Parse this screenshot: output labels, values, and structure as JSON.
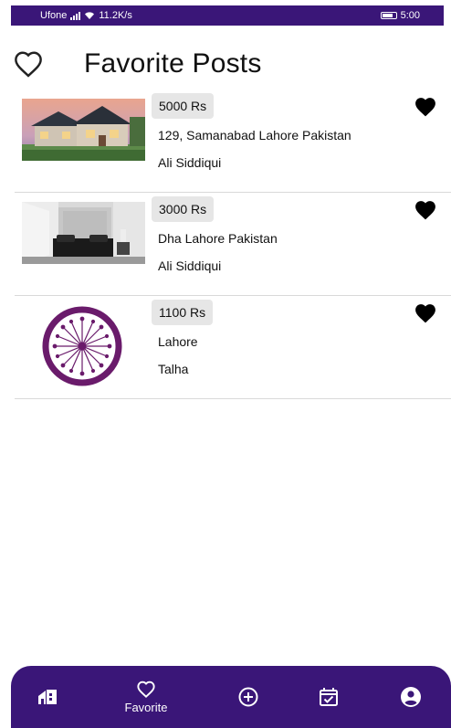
{
  "status_bar": {
    "carrier": "Ufone",
    "network_speed": "11.2K/s",
    "time": "5:00"
  },
  "header": {
    "title": "Favorite Posts",
    "icon": "heart-outline-icon"
  },
  "posts": [
    {
      "price": "5000 Rs",
      "address": "129, Samanabad Lahore Pakistan",
      "owner": "Ali Siddiqui",
      "image": "house-photo",
      "favorited": true
    },
    {
      "price": "3000 Rs",
      "address": "Dha Lahore Pakistan",
      "owner": "Ali Siddiqui",
      "image": "bedroom-photo",
      "favorited": true
    },
    {
      "price": "1100 Rs",
      "address": "Lahore",
      "owner": "Talha",
      "image": "purple-circle-logo",
      "favorited": true
    }
  ],
  "bottom_nav": {
    "items": [
      {
        "icon": "home-icon",
        "label": ""
      },
      {
        "icon": "heart-outline-icon",
        "label": "Favorite",
        "active": true
      },
      {
        "icon": "add-circle-icon",
        "label": ""
      },
      {
        "icon": "calendar-check-icon",
        "label": ""
      },
      {
        "icon": "account-icon",
        "label": ""
      }
    ]
  },
  "colors": {
    "primary": "#3a1678",
    "logo_purple": "#6a1b6b",
    "chip_bg": "#e6e6e6"
  }
}
